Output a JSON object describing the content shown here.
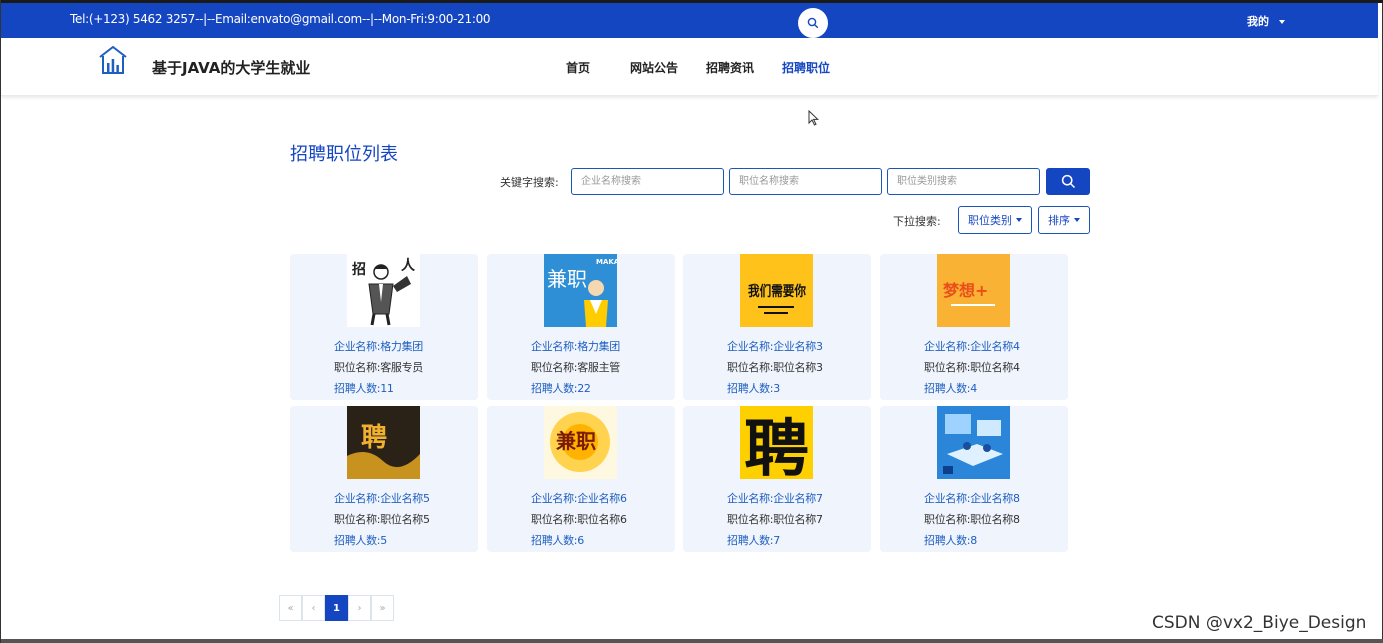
{
  "topbar": {
    "contact": "Tel:(+123) 5462 3257--|--Email:envato@gmail.com--|--Mon-Fri:9:00-21:00",
    "me_label": "我的"
  },
  "navbar": {
    "site_name": "基于JAVA的大学生就业",
    "menu": [
      "首页",
      "网站公告",
      "招聘资讯",
      "招聘职位"
    ],
    "active_index": 3
  },
  "main": {
    "title": "招聘职位列表",
    "keyword_label": "关键字搜索:",
    "placeholders": {
      "company": "企业名称搜索",
      "position": "职位名称搜索",
      "category": "职位类别搜索"
    },
    "dropdown_label": "下拉搜索:",
    "dropdown_category": "职位类别",
    "dropdown_sort": "排序"
  },
  "cards": [
    {
      "company": "企业名称:格力集团",
      "position": "职位名称:客服专员",
      "count": "招聘人数:11",
      "thumb": "man-with-megaphone"
    },
    {
      "company": "企业名称:格力集团",
      "position": "职位名称:客服主管",
      "count": "招聘人数:22",
      "thumb": "part-time-poster",
      "thumb_text": "兼职",
      "thumb_badge": "MAKA"
    },
    {
      "company": "企业名称:企业名称3",
      "position": "职位名称:职位名称3",
      "count": "招聘人数:3",
      "thumb": "we-want-you-poster",
      "thumb_text": "我们需要你"
    },
    {
      "company": "企业名称:企业名称4",
      "position": "职位名称:职位名称4",
      "count": "招聘人数:4",
      "thumb": "dream-poster",
      "thumb_text": "梦想+"
    },
    {
      "company": "企业名称:企业名称5",
      "position": "职位名称:职位名称5",
      "count": "招聘人数:5",
      "thumb": "hire-poster",
      "thumb_text": "聘"
    },
    {
      "company": "企业名称:企业名称6",
      "position": "职位名称:职位名称6",
      "count": "招聘人数:6",
      "thumb": "part-time-burst",
      "thumb_text": "兼职"
    },
    {
      "company": "企业名称:企业名称7",
      "position": "职位名称:职位名称7",
      "count": "招聘人数:7",
      "thumb": "hire-yellow-poster",
      "thumb_text": "聘"
    },
    {
      "company": "企业名称:企业名称8",
      "position": "职位名称:职位名称8",
      "count": "招聘人数:8",
      "thumb": "office-illustration"
    }
  ],
  "pagination": {
    "first": "«",
    "prev": "‹",
    "current": "1",
    "next": "›",
    "last": "»"
  },
  "watermark": "CSDN @vx2_Biye_Design",
  "colors": {
    "brand": "#1546c2",
    "card_bg": "#eff4fd"
  }
}
